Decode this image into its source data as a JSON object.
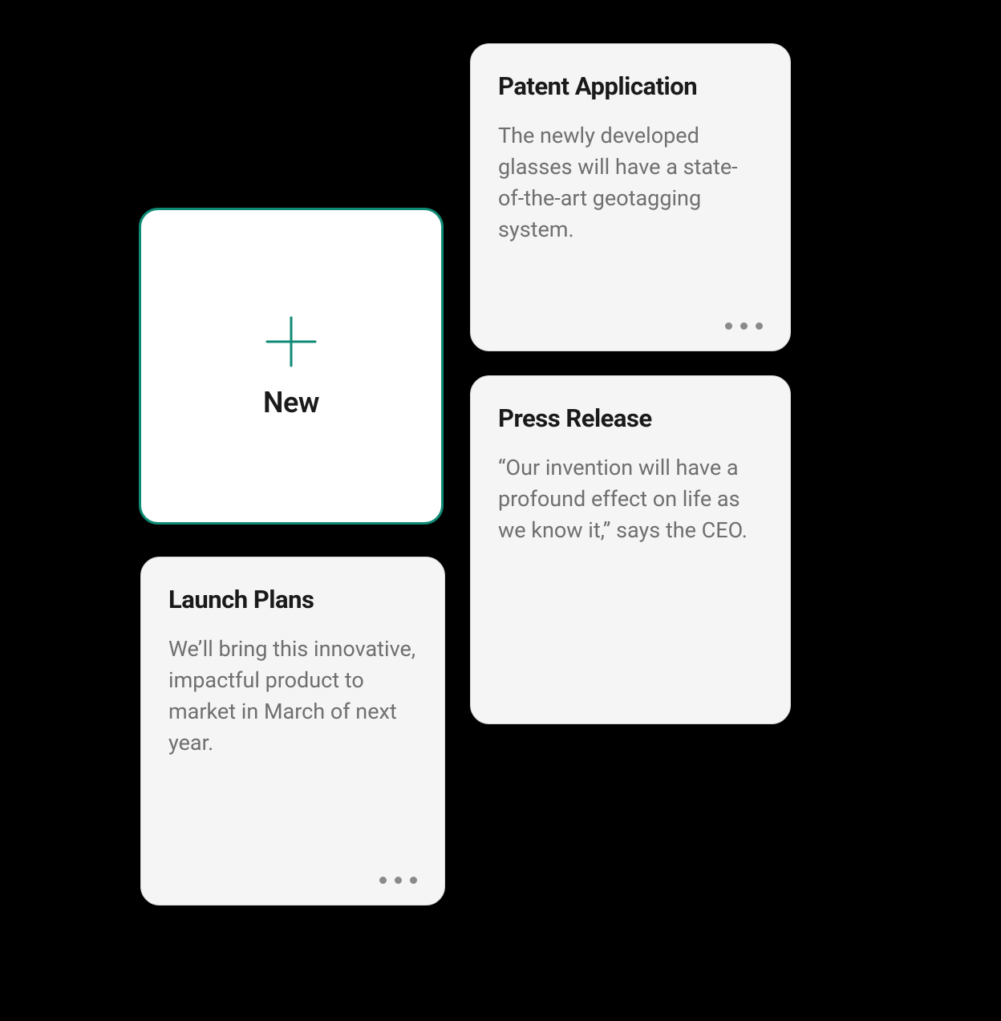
{
  "colors": {
    "accent": "#0f8a75",
    "card_bg": "#f5f5f5",
    "card_border": "#d8d8d8",
    "text_primary": "#1a1a1a",
    "text_secondary": "#6f6f6f",
    "dot": "#8a8a8a"
  },
  "new_card": {
    "label": "New"
  },
  "cards": {
    "patent": {
      "title": "Patent Application",
      "body": "The newly developed glasses will have a state-of-the-art geotagging system."
    },
    "press": {
      "title": "Press Release",
      "body": "“Our invention will have a profound effect on life as we know it,” says the CEO."
    },
    "launch": {
      "title": "Launch Plans",
      "body": "We’ll bring this innovative, impactful product to market in March of next year."
    }
  }
}
